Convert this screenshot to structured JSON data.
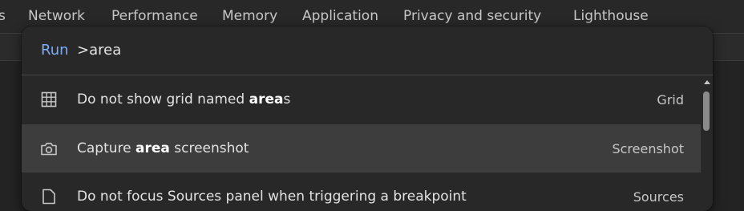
{
  "tabs": [
    "s",
    "Network",
    "Performance",
    "Memory",
    "Application",
    "Privacy and security",
    "Lighthouse"
  ],
  "command_menu": {
    "prompt_label": "Run",
    "query": ">area",
    "items": [
      {
        "icon": "grid-icon",
        "title_pre": "Do not show grid named ",
        "title_match": "area",
        "title_post": "s",
        "category": "Grid",
        "selected": false
      },
      {
        "icon": "camera-icon",
        "title_pre": "Capture ",
        "title_match": "area",
        "title_post": " screenshot",
        "category": "Screenshot",
        "selected": true
      },
      {
        "icon": "file-icon",
        "title_pre": "Do not focus Sources panel when triggering a breakpoint",
        "title_match": "",
        "title_post": "",
        "category": "Sources",
        "selected": false
      }
    ]
  },
  "colors": {
    "accent": "#7cacf8",
    "palette_background": "#282828",
    "selected_row": "#3d3d3d"
  }
}
